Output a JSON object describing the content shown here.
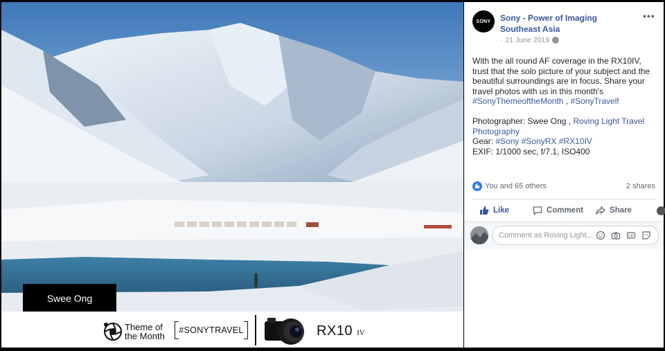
{
  "photo": {
    "name_tag": "Swee Ong",
    "banner": {
      "theme_line1": "Theme of",
      "theme_line2": "the Month",
      "hashtag": "#SONYTRAVEL",
      "model": "RX10",
      "model_suffix": "IV"
    }
  },
  "post": {
    "avatar_text": "SONY",
    "page_name": "Sony - Power of Imaging Southeast Asia",
    "more_label": "•••",
    "date": "21 June 2019",
    "date_prefix": "·",
    "body_p1": "With the all round AF coverage in the RX10IV, trust that the solo picture of your subject and the beautiful surroundings are in focus. Share your travel photos with us in this month's ",
    "hashtag1": "#SonyThemeoftheMonth",
    "separator": " , ",
    "hashtag2": "#SonyTravel",
    "body_p1_end": "!",
    "photographer_label": "Photographer: Swee Ong , ",
    "photographer_link": "Roving Light Travel Photography",
    "gear_label": "Gear: ",
    "gear_tags": "#Sony #SonyRX #RX10IV",
    "exif": "EXIF: 1/1000 sec, f/7.1, ISO400"
  },
  "engagement": {
    "likes_text": "You and 65 others",
    "shares_text": "2 shares",
    "like_label": "Like",
    "comment_label": "Comment",
    "share_label": "Share"
  },
  "comment_box": {
    "placeholder": "Comment as Roving Light..."
  },
  "colors": {
    "link": "#385898",
    "like_blue": "#2f7bf0",
    "muted": "#606770"
  }
}
